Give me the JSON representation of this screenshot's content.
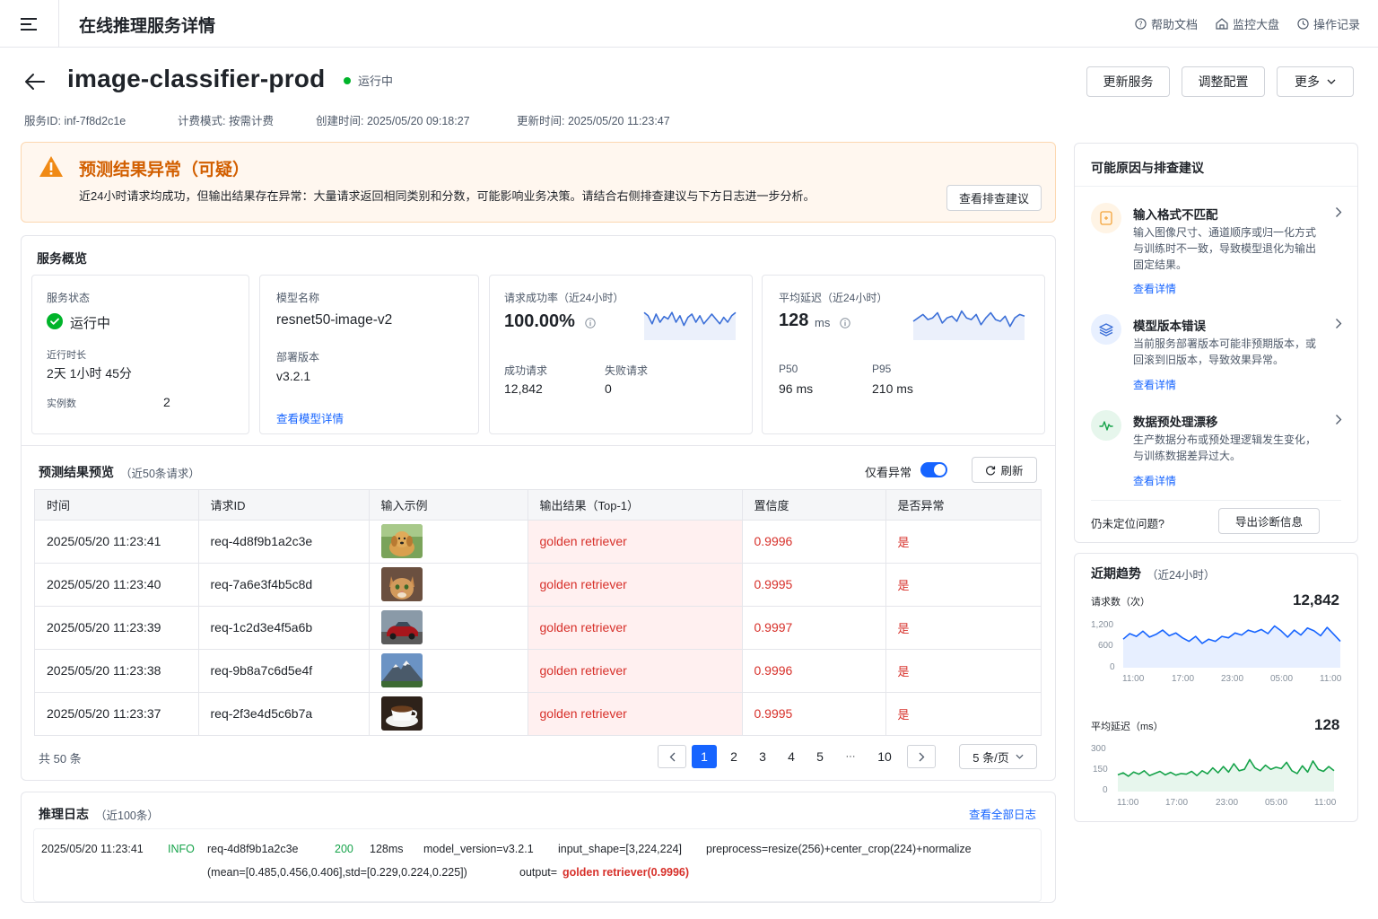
{
  "topbar": {
    "title": "在线推理服务详情",
    "links": [
      {
        "icon": "help-circle-icon",
        "label": "帮助文档"
      },
      {
        "icon": "dashboard-icon",
        "label": "监控大盘"
      },
      {
        "icon": "clock-icon",
        "label": "操作记录"
      }
    ]
  },
  "service": {
    "name": "image-classifier-prod",
    "status": "运行中",
    "status_color": "#00b42a",
    "actions": {
      "update": "更新服务",
      "config": "调整配置",
      "more": "更多"
    },
    "meta": {
      "id": "服务ID: inf-7f8d2c1e",
      "billing": "计费模式: 按需计费",
      "created": "创建时间: 2025/05/20 09:18:27",
      "updated": "更新时间: 2025/05/20 11:23:47"
    }
  },
  "alert": {
    "title": "预测结果异常（可疑）",
    "desc": "近24小时请求均成功，但输出结果存在异常：大量请求返回相同类别和分数，可能影响业务决策。请结合右侧排查建议与下方日志进一步分析。",
    "button": "查看排查建议",
    "color": "#d25f00"
  },
  "overview": {
    "title": "服务概览",
    "status_card": {
      "label": "服务状态",
      "value": "运行中",
      "uptime_label": "近行时长",
      "uptime": "2天 1小时 45分",
      "instances_label": "实例数",
      "instances": "2"
    },
    "model_card": {
      "label": "模型名称",
      "value": "resnet50-image-v2",
      "version_label": "部署版本",
      "version": "v3.2.1",
      "link": "查看模型详情"
    },
    "success_card": {
      "label": "请求成功率（近24小时）",
      "value": "100.00%",
      "ok_label": "成功请求",
      "ok": "12,842",
      "fail_label": "失败请求",
      "fail": "0",
      "spark": [
        52,
        48,
        38,
        50,
        40,
        47,
        44,
        52,
        40,
        48,
        36,
        46,
        50,
        40,
        48,
        38,
        44,
        50,
        44,
        38,
        46,
        40,
        48,
        52
      ]
    },
    "latency_card": {
      "label": "平均延迟（近24小时）",
      "value": "128",
      "unit": "ms",
      "p50_label": "P50",
      "p50": "96 ms",
      "p95_label": "P95",
      "p95": "210 ms",
      "spark": [
        40,
        44,
        48,
        42,
        44,
        50,
        38,
        44,
        46,
        40,
        52,
        44,
        42,
        48,
        36,
        44,
        50,
        42,
        40,
        46,
        34,
        44,
        48,
        46
      ]
    }
  },
  "preview": {
    "title": "预测结果预览",
    "subtitle": "（近50条请求）",
    "toggle_label": "仅看异常",
    "refresh": "刷新",
    "columns": [
      "时间",
      "请求ID",
      "输入示例",
      "输出结果（Top-1）",
      "置信度",
      "是否异常"
    ],
    "rows": [
      {
        "time": "2025/05/20 11:23:41",
        "id": "req-4d8f9b1a2c3e",
        "img": "dog",
        "output": "golden retriever",
        "conf": "0.9996",
        "abnormal": "是"
      },
      {
        "time": "2025/05/20 11:23:40",
        "id": "req-7a6e3f4b5c8d",
        "img": "cat",
        "output": "golden retriever",
        "conf": "0.9995",
        "abnormal": "是"
      },
      {
        "time": "2025/05/20 11:23:39",
        "id": "req-1c2d3e4f5a6b",
        "img": "car",
        "output": "golden retriever",
        "conf": "0.9997",
        "abnormal": "是"
      },
      {
        "time": "2025/05/20 11:23:38",
        "id": "req-9b8a7c6d5e4f",
        "img": "mountain",
        "output": "golden retriever",
        "conf": "0.9996",
        "abnormal": "是"
      },
      {
        "time": "2025/05/20 11:23:37",
        "id": "req-2f3e4d5c6b7a",
        "img": "coffee",
        "output": "golden retriever",
        "conf": "0.9995",
        "abnormal": "是"
      }
    ],
    "total": "共 50 条",
    "pages": [
      "1",
      "2",
      "3",
      "4",
      "5",
      "···",
      "10"
    ],
    "page_size": "5 条/页"
  },
  "causes": {
    "title": "可能原因与排查建议",
    "items": [
      {
        "icon": "file-format-icon",
        "title": "输入格式不匹配",
        "desc": "输入图像尺寸、通道顺序或归一化方式与训练时不一致，导致模型退化为输出固定结果。",
        "link": "查看详情",
        "color": "#f3a33a",
        "bg": "#fff4e5"
      },
      {
        "icon": "layers-icon",
        "title": "模型版本错误",
        "desc": "当前服务部署版本可能非预期版本，或回滚到旧版本，导致效果异常。",
        "link": "查看详情",
        "color": "#3b6fd8",
        "bg": "#e8f0ff"
      },
      {
        "icon": "pulse-icon",
        "title": "数据预处理漂移",
        "desc": "生产数据分布或预处理逻辑发生变化，与训练数据差异过大。",
        "link": "查看详情",
        "color": "#16a34a",
        "bg": "#e6f6ec"
      }
    ],
    "footer_text": "仍未定位问题?",
    "export": "导出诊断信息"
  },
  "trends": {
    "title": "近期趋势",
    "subtitle": "（近24小时）",
    "requests": {
      "label": "请求数（次）",
      "value": "12,842",
      "color": "#1664ff",
      "y_ticks": [
        "1,200",
        "600",
        "0"
      ],
      "x_ticks": [
        "11:00",
        "17:00",
        "23:00",
        "05:00",
        "11:00"
      ],
      "ylim": [
        0,
        1600
      ],
      "values": [
        820,
        980,
        900,
        1050,
        880,
        960,
        1080,
        920,
        1000,
        860,
        760,
        900,
        700,
        820,
        760,
        900,
        860,
        1000,
        940,
        1080,
        1020,
        1100,
        980,
        1200,
        1060,
        880,
        1080,
        940,
        1140,
        1060,
        920,
        1160,
        960,
        760
      ]
    },
    "latency": {
      "label": "平均延迟（ms）",
      "value": "128",
      "color": "#16a34a",
      "y_ticks": [
        "300",
        "150",
        "0"
      ],
      "x_ticks": [
        "11:00",
        "17:00",
        "23:00",
        "05:00",
        "11:00"
      ],
      "ylim": [
        0,
        400
      ],
      "values": [
        120,
        135,
        110,
        140,
        125,
        150,
        115,
        130,
        145,
        120,
        138,
        118,
        130,
        125,
        145,
        115,
        150,
        128,
        170,
        135,
        180,
        140,
        200,
        150,
        160,
        230,
        170,
        150,
        190,
        160,
        175,
        165,
        210,
        150,
        130,
        185,
        140,
        220,
        160,
        145,
        180,
        150
      ]
    }
  },
  "logs": {
    "title": "推理日志",
    "subtitle": "（近100条）",
    "link": "查看全部日志",
    "line": {
      "time": "2025/05/20 11:23:41",
      "level": "INFO",
      "req": "req-4d8f9b1a2c3e",
      "code": "200",
      "latency": "128ms",
      "version": "model_version=v3.2.1",
      "shape": "input_shape=[3,224,224]",
      "pre": "preprocess=resize(256)+center_crop(224)+normalize",
      "norm": "(mean=[0.485,0.456,0.406],std=[0.229,0.224,0.225])",
      "out_label": "output=",
      "out_value": "golden retriever(0.9996)"
    }
  }
}
